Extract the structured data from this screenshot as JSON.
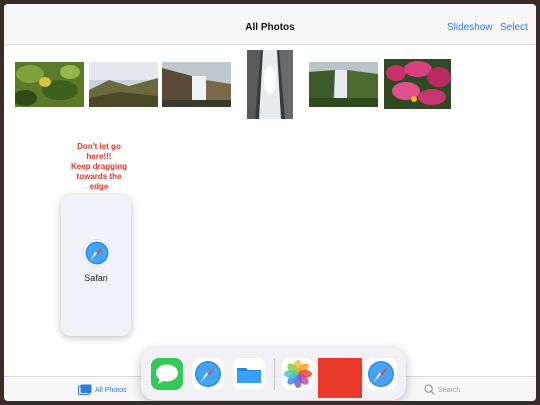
{
  "navbar": {
    "title": "All Photos",
    "slideshow_label": "Slideshow",
    "select_label": "Select"
  },
  "photos": [
    {
      "subject": "green leaves with yellow fruit"
    },
    {
      "subject": "landscape under sky"
    },
    {
      "subject": "waterfall in canyon"
    },
    {
      "subject": "waterfall close-up"
    },
    {
      "subject": "waterfall with green cliffs"
    },
    {
      "subject": "pink flowers"
    }
  ],
  "drag_hint": {
    "line1": "Don't let go",
    "line2": "here!!!",
    "line3": "Keep dragging",
    "line4": "towards the",
    "line5": "edge"
  },
  "drag_card": {
    "app_label": "Safari",
    "icon": "safari-icon"
  },
  "tabbar": {
    "photos_label": "All Photos",
    "search_label": "Search"
  },
  "dock": {
    "apps": [
      "messages-icon",
      "safari-icon",
      "files-icon",
      "photos-icon",
      "recent-app-red",
      "safari-icon"
    ]
  },
  "colors": {
    "accent": "#2f7bd6",
    "warning": "#e0352b",
    "messages": "#34c759",
    "files": "#1e88e5"
  }
}
